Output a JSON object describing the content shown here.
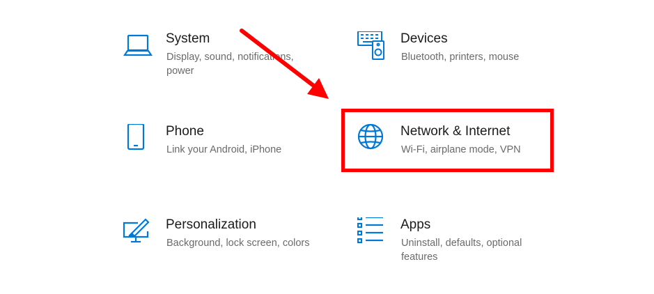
{
  "colors": {
    "accent": "#0078d7",
    "annotation": "#ff0000"
  },
  "tiles": [
    {
      "icon": "laptop-icon",
      "title": "System",
      "desc": "Display, sound, notifications, power"
    },
    {
      "icon": "devices-icon",
      "title": "Devices",
      "desc": "Bluetooth, printers, mouse"
    },
    {
      "icon": "phone-icon",
      "title": "Phone",
      "desc": "Link your Android, iPhone"
    },
    {
      "icon": "globe-icon",
      "title": "Network & Internet",
      "desc": "Wi-Fi, airplane mode, VPN"
    },
    {
      "icon": "personalization-icon",
      "title": "Personalization",
      "desc": "Background, lock screen, colors"
    },
    {
      "icon": "apps-list-icon",
      "title": "Apps",
      "desc": "Uninstall, defaults, optional features"
    }
  ],
  "annotations": {
    "arrow": "red-arrow",
    "highlight": "red-highlight-box"
  }
}
